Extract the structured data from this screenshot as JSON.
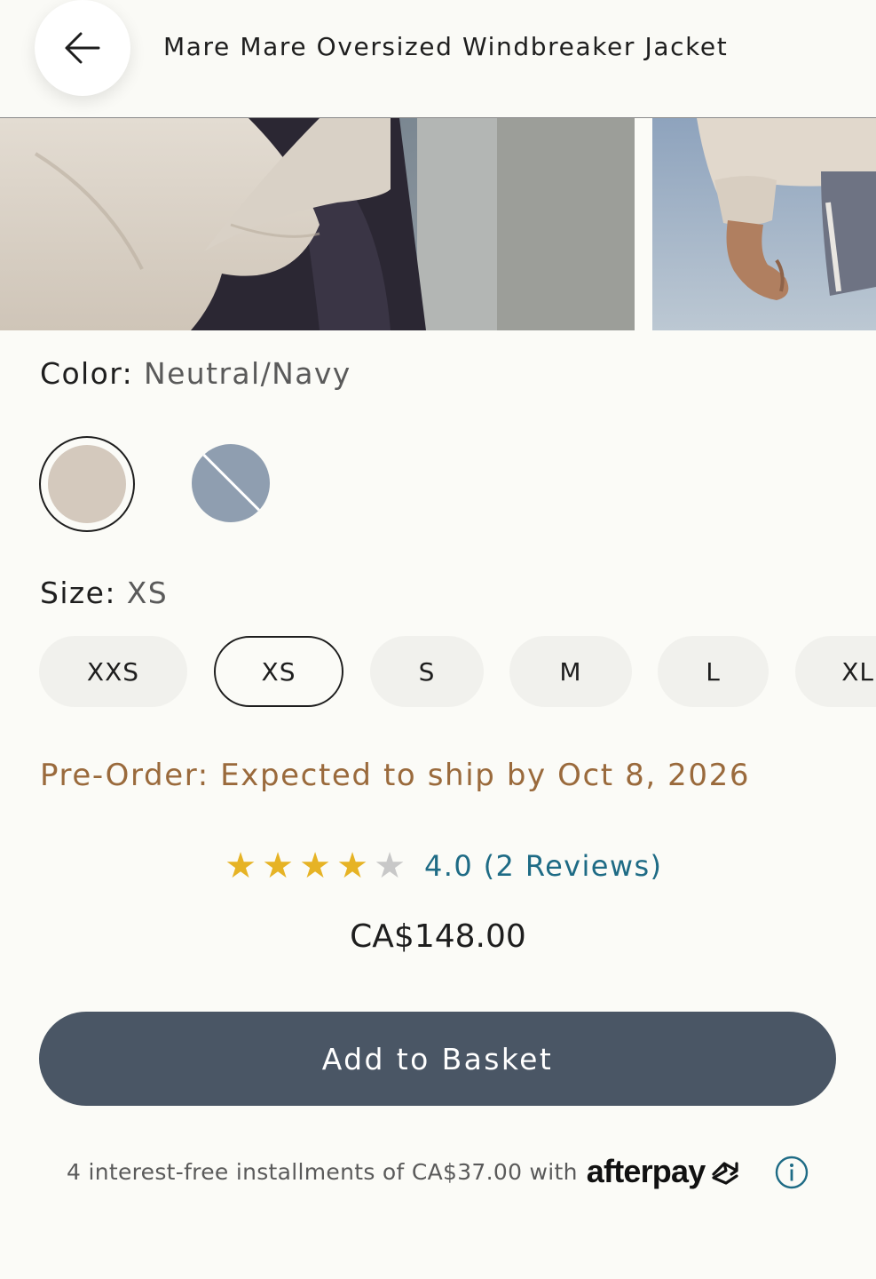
{
  "header": {
    "title": "Mare Mare Oversized Windbreaker Jacket",
    "back_icon": "arrow-left-icon"
  },
  "gallery": {
    "photos": [
      "jacket-photo-1",
      "jacket-photo-2"
    ]
  },
  "color": {
    "label": "Color:",
    "value": "Neutral/Navy",
    "swatches": [
      {
        "hex": "#d4c9bd",
        "selected": true,
        "available": true
      },
      {
        "hex": "#8f9eb0",
        "selected": false,
        "available": false
      }
    ]
  },
  "size": {
    "label": "Size:",
    "value": "XS",
    "options": [
      "XXS",
      "XS",
      "S",
      "M",
      "L",
      "XL"
    ],
    "selected": "XS"
  },
  "preorder": "Pre-Order: Expected to ship by Oct 8, 2026",
  "rating": {
    "stars": 4.0,
    "max": 5,
    "text": "4.0 (2 Reviews)"
  },
  "price": "CA$148.00",
  "actions": {
    "add_to_basket": "Add to Basket"
  },
  "afterpay": {
    "text": "4 interest-free installments of CA$37.00 with",
    "logo": "afterpay"
  },
  "colors": {
    "button": "#4a5665",
    "preorder": "#9a6a3c",
    "rating_link": "#1e6b85",
    "star": "#e6b325"
  }
}
